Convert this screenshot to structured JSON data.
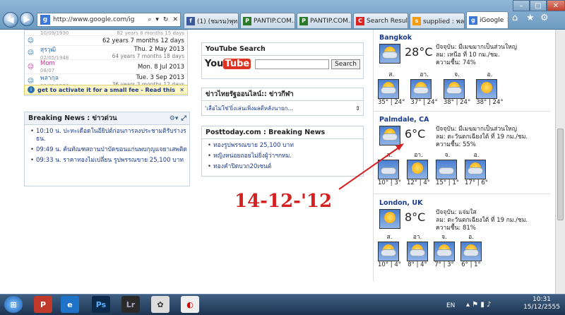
{
  "browser": {
    "address": "http://www.google.com/ig",
    "tabs": [
      {
        "label": "(1) (ชมรม)พุท...",
        "icon": "facebook-icon"
      },
      {
        "label": "PANTIP.COM...",
        "icon": "pantip-icon"
      },
      {
        "label": "PANTIP.COM...",
        "icon": "pantip-icon"
      },
      {
        "label": "Search Resul...",
        "icon": "search-results-icon"
      },
      {
        "label": "supplied : พล...",
        "icon": "orange-doc-icon"
      },
      {
        "label": "iGoogle",
        "icon": "google-icon",
        "active": true
      }
    ]
  },
  "birthdays": {
    "rows": [
      {
        "name": "",
        "date": "10/09/1930",
        "info": "82 years 8 months 15 days"
      },
      {
        "name": "",
        "date": "",
        "info": "62 years 7 months 12 days"
      },
      {
        "name": "สุรวุฒิ",
        "date": "02/05/1948",
        "info2": "Thu. 2 May 2013",
        "info": "64 years 7 months 18 days"
      },
      {
        "name": "Mom",
        "date": "08/07",
        "info2": "Mon. 8 Jul 2013"
      },
      {
        "name": "พลากุล",
        "date": "03/09/1976",
        "info2": "Tue. 3 Sep 2013",
        "info": "36 years 3 months 12 days"
      }
    ],
    "notice": "get to activate it for a small fee - Read this"
  },
  "breaking": {
    "title": "Breaking News : ข่าวด่วน",
    "items": [
      "10:10 น. ปะทะเดือดในอียิปต์ก่อนการลงประชามติรับร่างรธน.",
      "09:49 น. ค้นทัณฑสถานป่าบัดขอนแก่นพบกุญแจยาเสพติด",
      "09:33 น. ราคาทองไม่เปลี่ยน รูปพรรณขาย 25,100 บาท"
    ]
  },
  "youtube": {
    "title": "YouTube Search",
    "button": "Search",
    "logo_you": "You",
    "logo_tube": "Tube"
  },
  "thainews": {
    "title": "ข่าวไทยรัฐออนไลน์:: ข่าวกีฬา",
    "item": "'เลือไม่ใช่'ยิ่งเล่นเพิ่งผลดีหลังนายก..."
  },
  "posttoday": {
    "title": "Posttoday.com : Breaking News",
    "items": [
      "ทองรูปพรรณขาย 25,100 บาท",
      "หญิงหน่อยถอยไม่ยิ่งผู้ว่าฯกทม.",
      "ทองคำปิดบวก20เซนต์"
    ]
  },
  "weather": [
    {
      "city": "Bangkok",
      "temp": "28°C",
      "line1": "ปัจจุบัน: มีเมฆมากเป็นส่วนใหญ่",
      "line2": "ลม: เหนือ ที่ 10 กม./ชม.",
      "line3": "ความชื้น: 74%",
      "days": [
        {
          "d": "ส.",
          "t": "35° | 24°"
        },
        {
          "d": "อา.",
          "t": "37° | 24°"
        },
        {
          "d": "จ.",
          "t": "38° | 24°"
        },
        {
          "d": "อ.",
          "t": "38° | 24°"
        }
      ]
    },
    {
      "city": "Palmdale, CA",
      "temp": "6°C",
      "line1": "ปัจจุบัน: มีเมฆมากเป็นส่วนใหญ่",
      "line2": "ลม: ตะวันตกเฉียงใต้ ที่ 19 กม./ชม.",
      "line3": "ความชื้น: 55%",
      "days": [
        {
          "d": "ส.",
          "t": "10° | 3°"
        },
        {
          "d": "อา.",
          "t": "12° | 4°"
        },
        {
          "d": "จ.",
          "t": "15° | 1°"
        },
        {
          "d": "อ.",
          "t": "17° | 6°"
        }
      ]
    },
    {
      "city": "London, UK",
      "temp": "8°C",
      "line1": "ปัจจุบัน: แจ่มใส",
      "line2": "ลม: ตะวันตกเฉียงใต้ ที่ 19 กม./ชม.",
      "line3": "ความชื้น: 81%",
      "days": [
        {
          "d": "ส.",
          "t": "10° | 4°"
        },
        {
          "d": "อา.",
          "t": "8° | 4°"
        },
        {
          "d": "จ.",
          "t": "7° | 3°"
        },
        {
          "d": "อ.",
          "t": "6° | 1°"
        }
      ]
    }
  ],
  "annotation": "14-12-'12",
  "taskbar": {
    "lang": "EN",
    "time": "10:31",
    "date": "15/12/2555"
  },
  "colors": {
    "accent": "#1a3a8a",
    "annotation": "#d42020"
  }
}
